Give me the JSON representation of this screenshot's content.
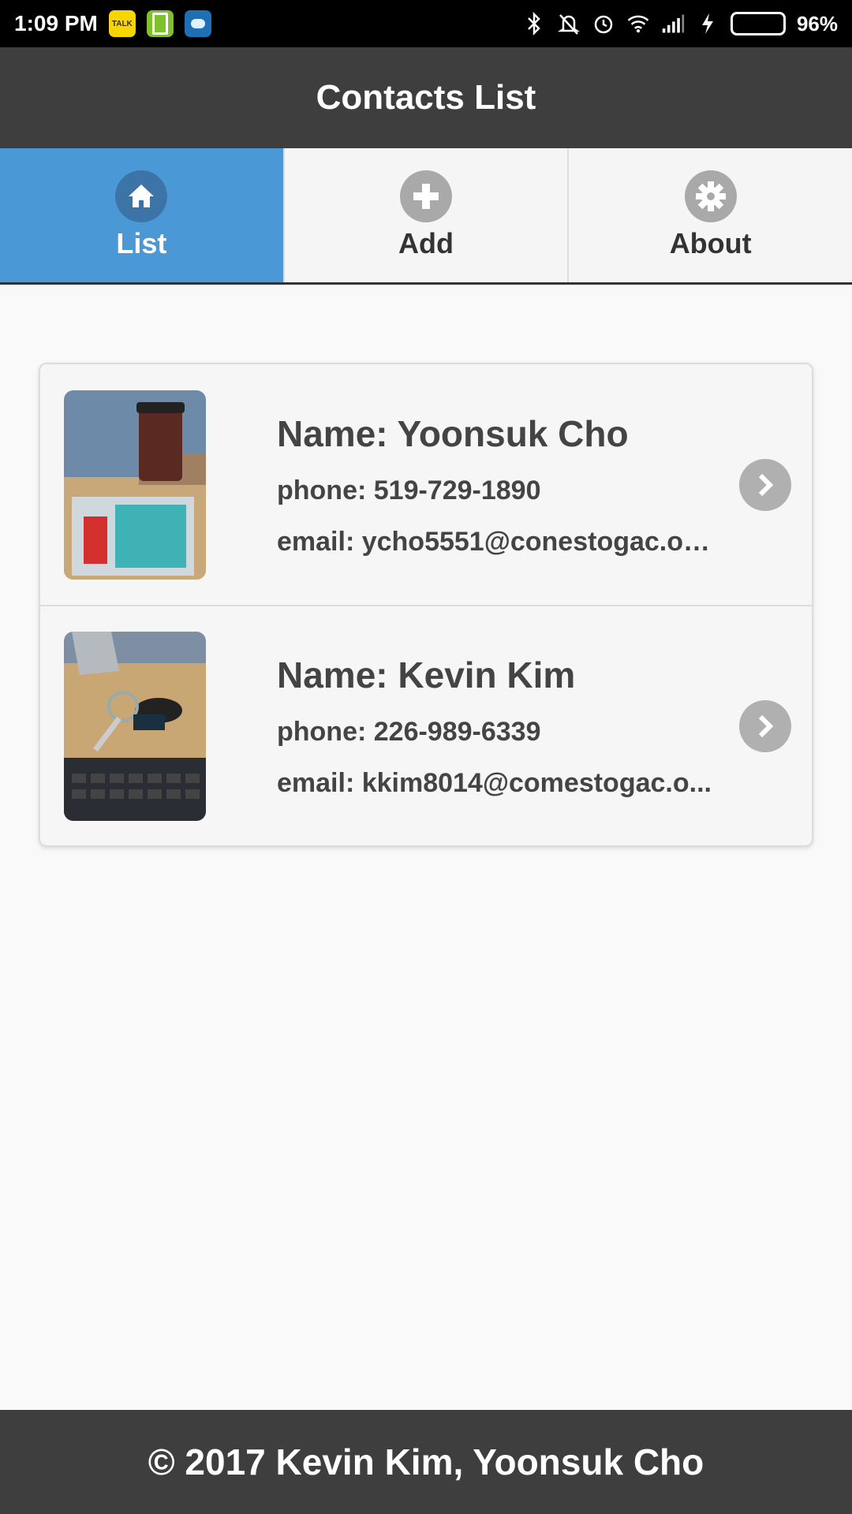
{
  "status_bar": {
    "time": "1:09 PM",
    "talk_label": "TALK",
    "battery_percent": "96%",
    "battery_level": 0.96,
    "icons": [
      "kakaotalk-icon",
      "battery-app-icon",
      "weather-icon",
      "bluetooth-icon",
      "mute-icon",
      "alarm-icon",
      "wifi-icon",
      "signal-icon",
      "charging-icon",
      "battery-icon"
    ]
  },
  "header": {
    "title": "Contacts List"
  },
  "tabs": [
    {
      "label": "List",
      "icon": "home-icon",
      "active": true
    },
    {
      "label": "Add",
      "icon": "plus-icon",
      "active": false
    },
    {
      "label": "About",
      "icon": "gear-icon",
      "active": false
    }
  ],
  "contacts": [
    {
      "name": "Name: Yoonsuk Cho",
      "phone": "phone: 519-729-1890",
      "email": "email: ycho5551@conestogac.on...",
      "photo": "coffee-cup-photo"
    },
    {
      "name": "Name: Kevin Kim",
      "phone": "phone: 226-989-6339",
      "email": "email: kkim8014@comestogac.o...",
      "photo": "keys-photo"
    }
  ],
  "footer": {
    "text": "© 2017 Kevin Kim, Yoonsuk Cho"
  },
  "colors": {
    "header_bg": "#3e3e3e",
    "active_tab": "#4b98d6",
    "chevron_bg": "#b0b0b0",
    "battery_fill": "#5bd200"
  }
}
